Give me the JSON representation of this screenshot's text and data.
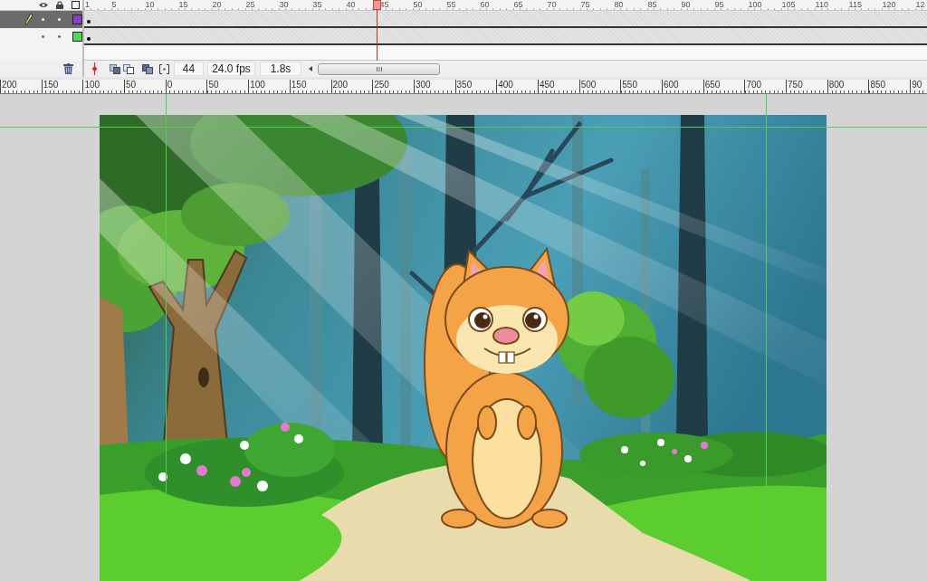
{
  "timeline": {
    "frame_numbers": [
      "1",
      "5",
      "10",
      "15",
      "20",
      "25",
      "30",
      "35",
      "40",
      "45",
      "50",
      "55",
      "60",
      "65",
      "70",
      "75",
      "80",
      "85",
      "90",
      "95",
      "100",
      "105",
      "110",
      "115",
      "120",
      "12"
    ],
    "layers": [
      {
        "selected": true,
        "color": "#8a3fc2"
      },
      {
        "selected": false,
        "color": "#55d65a"
      }
    ],
    "current_frame": "44",
    "frame_rate": "24.0 fps",
    "elapsed_time": "1.8s"
  },
  "stage_ruler": {
    "labels": [
      "200",
      "150",
      "100",
      "50",
      "0",
      "50",
      "100",
      "150",
      "200",
      "250",
      "300",
      "350",
      "400",
      "450",
      "500",
      "550",
      "600",
      "650",
      "700",
      "750",
      "800",
      "850",
      "90"
    ]
  }
}
